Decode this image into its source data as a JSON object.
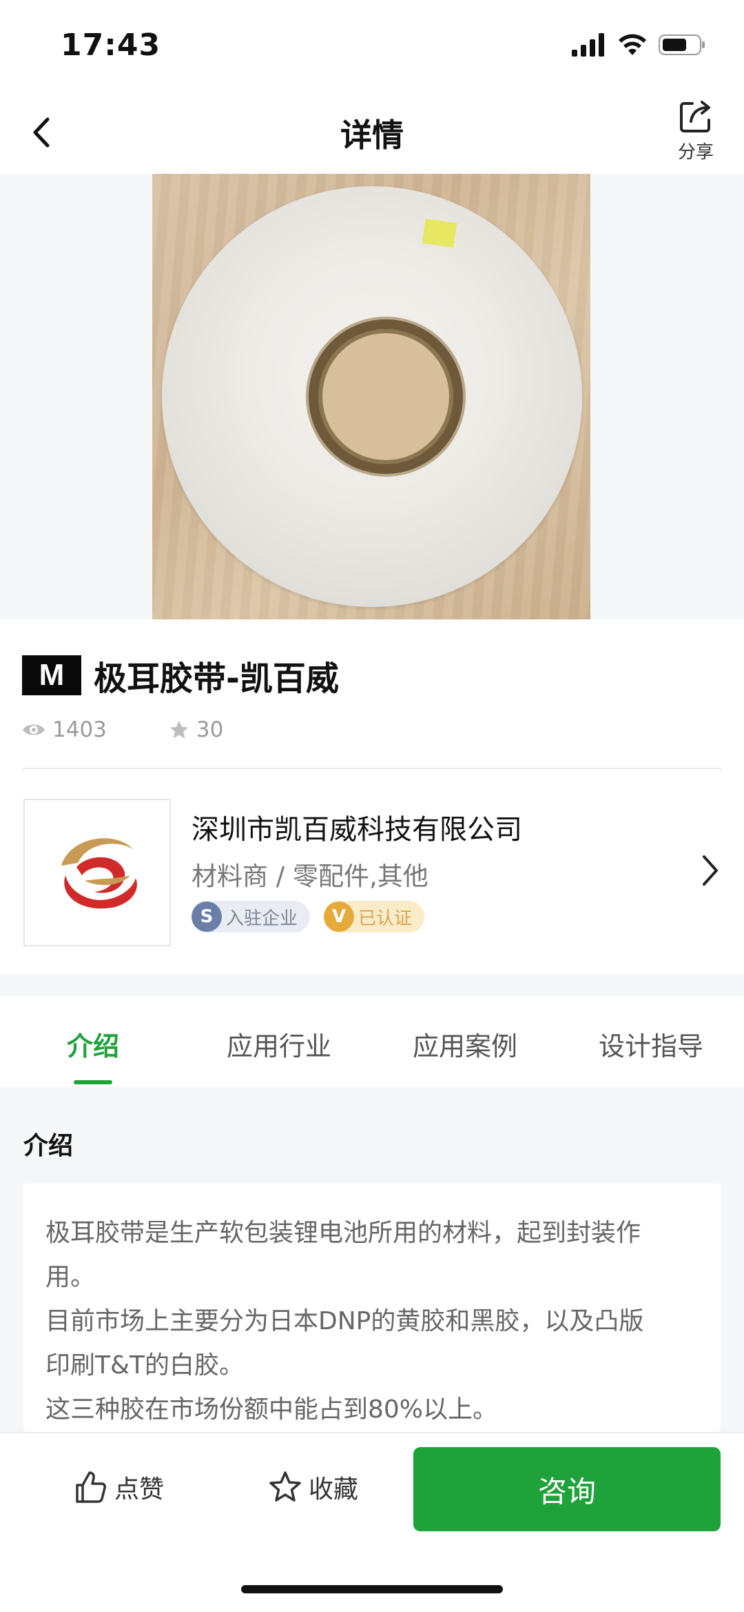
{
  "status_bar": {
    "time": "17:43"
  },
  "nav": {
    "title": "详情",
    "share_label": "分享"
  },
  "product": {
    "badge": "M",
    "title": "极耳胶带-凯百威",
    "views": "1403",
    "favorites": "30"
  },
  "company": {
    "name": "深圳市凯百威科技有限公司",
    "category": "材料商 / 零配件,其他",
    "tag_settled_icon": "S",
    "tag_settled": "入驻企业",
    "tag_cert_icon": "V",
    "tag_cert": "已认证"
  },
  "tabs": [
    {
      "label": "介绍",
      "active": true
    },
    {
      "label": "应用行业",
      "active": false
    },
    {
      "label": "应用案例",
      "active": false
    },
    {
      "label": "设计指导",
      "active": false
    }
  ],
  "intro": {
    "heading": "介绍",
    "lines": [
      "极耳胶带是生产软包装锂电池所用的材料，起到封装作",
      "用。",
      "目前市场上主要分为日本DNP的黄胶和黑胶，以及凸版",
      "印刷T&T的白胶。",
      "这三种胶在市场份额中能占到80%以上。"
    ]
  },
  "bottom_bar": {
    "like_label": "点赞",
    "fav_label": "收藏",
    "consult_label": "咨询"
  },
  "colors": {
    "accent": "#1fa23a",
    "muted": "#9a9a9a"
  },
  "icons": [
    "back-icon",
    "share-icon",
    "eye-icon",
    "star-icon",
    "chevron-right-icon",
    "thumbs-up-icon",
    "star-outline-icon",
    "signal-icon",
    "wifi-icon",
    "battery-icon"
  ]
}
